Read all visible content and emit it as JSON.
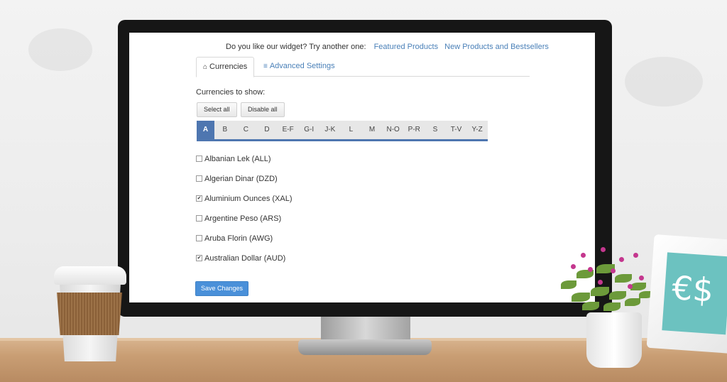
{
  "promo": {
    "text": "Do you like our widget? Try another one:",
    "links": [
      "Featured Products",
      "New Products and Bestsellers"
    ]
  },
  "tabs": [
    {
      "label": "Currencies",
      "icon": "bank-icon",
      "active": true
    },
    {
      "label": "Advanced Settings",
      "icon": "sliders-icon",
      "active": false
    }
  ],
  "currencies_label": "Currencies to show:",
  "buttons": {
    "select_all": "Select all",
    "disable_all": "Disable all",
    "save": "Save Changes"
  },
  "letters": [
    "A",
    "B",
    "C",
    "D",
    "E-F",
    "G-I",
    "J-K",
    "L",
    "M",
    "N-O",
    "P-R",
    "S",
    "T-V",
    "Y-Z"
  ],
  "active_letter": "A",
  "currencies": [
    {
      "name": "Albanian Lek (ALL)",
      "checked": false
    },
    {
      "name": "Algerian Dinar (DZD)",
      "checked": false
    },
    {
      "name": "Aluminium Ounces (XAL)",
      "checked": true
    },
    {
      "name": "Argentine Peso (ARS)",
      "checked": false
    },
    {
      "name": "Aruba Florin (AWG)",
      "checked": false
    },
    {
      "name": "Australian Dollar (AUD)",
      "checked": true
    }
  ],
  "colors": {
    "accent": "#4e76b0",
    "link": "#4a80b8",
    "save": "#4a90d9"
  }
}
